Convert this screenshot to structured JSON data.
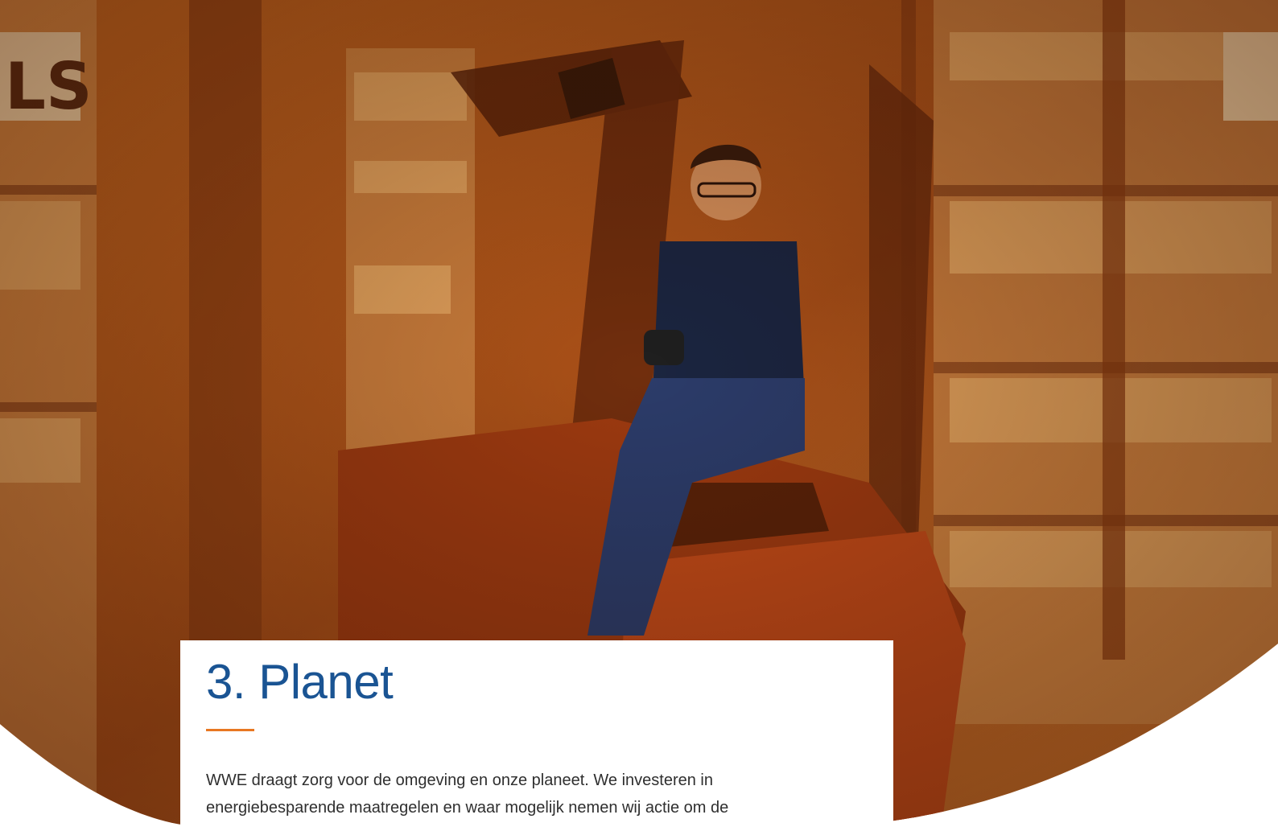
{
  "section": {
    "title": "3. Planet",
    "body": "WWE draagt zorg voor de omgeving en onze planeet. We investeren in energiebesparende maatregelen en waar mogelijk nemen wij actie om de"
  },
  "colors": {
    "title": "#1a5493",
    "accent_rule": "#e87722",
    "photo_tint": "#b8561a",
    "text": "#2f2f2f"
  }
}
